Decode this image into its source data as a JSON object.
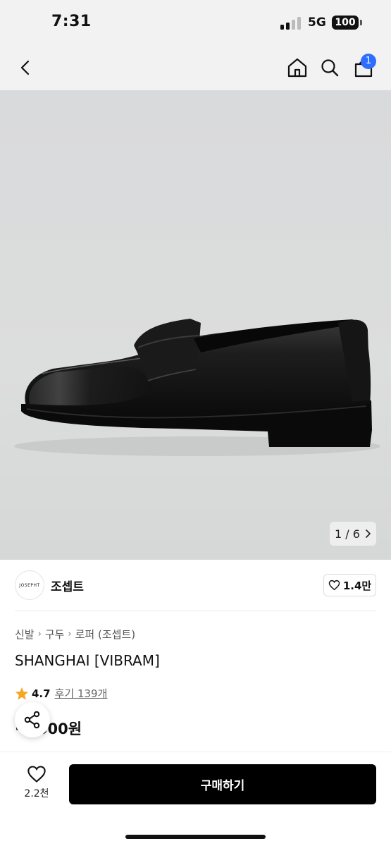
{
  "status_bar": {
    "time": "7:31",
    "network": "5G",
    "battery": "100"
  },
  "nav": {
    "back_icon": "chevron-left-icon",
    "home_icon": "home-icon",
    "search_icon": "search-icon",
    "cart_icon": "bag-icon",
    "cart_count": "1"
  },
  "gallery": {
    "pager": "1 / 6"
  },
  "brand": {
    "logo_text": "JOSEPHT",
    "name": "조셉트",
    "like_count": "1.4만"
  },
  "product": {
    "breadcrumb": [
      "신발",
      "구두",
      "로퍼 (조셉트)"
    ],
    "title": "SHANGHAI [VIBRAM]",
    "rating": "4.7",
    "reviews": "후기 139개",
    "price": "···,000원"
  },
  "bottom_bar": {
    "wish_count": "2.2천",
    "buy_label": "구매하기"
  },
  "colors": {
    "accent": "#2f6dff",
    "star": "#f5a623",
    "buy_button": "#000000"
  }
}
